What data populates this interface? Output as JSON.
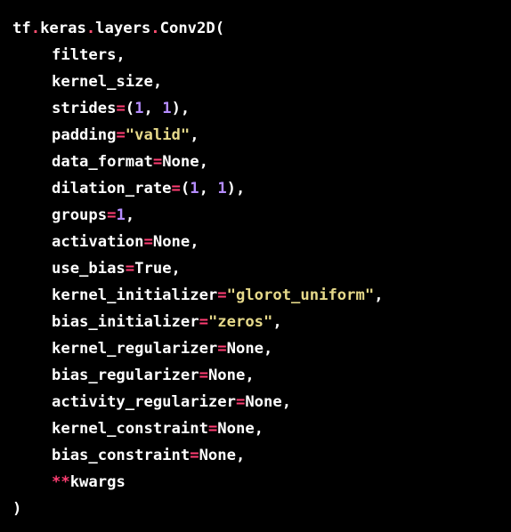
{
  "colors": {
    "background": "#000000",
    "text": "#ffffff",
    "operator": "#ff3e73",
    "number": "#b58cff",
    "string": "#e6d98a"
  },
  "code": {
    "line1": {
      "module": "tf",
      "dot1": ".",
      "sub1": "keras",
      "dot2": ".",
      "sub2": "layers",
      "dot3": ".",
      "call": "Conv2D(",
      "_text": "tf.keras.layers.Conv2D("
    },
    "line2": {
      "name": "filters,",
      "_text": "filters,"
    },
    "line3": {
      "name": "kernel_size,",
      "_text": "kernel_size,"
    },
    "line4": {
      "name": "strides",
      "op": "=",
      "p1": "(",
      "n1": "1",
      "sep": ", ",
      "n2": "1",
      "p2": "),",
      "_text": "strides=(1, 1),"
    },
    "line5": {
      "name": "padding",
      "op": "=",
      "value": "\"valid\"",
      "tail": ",",
      "_text": "padding=\"valid\","
    },
    "line6": {
      "name": "data_format",
      "op": "=",
      "value": "None,",
      "_text": "data_format=None,"
    },
    "line7": {
      "name": "dilation_rate",
      "op": "=",
      "p1": "(",
      "n1": "1",
      "sep": ", ",
      "n2": "1",
      "p2": "),",
      "_text": "dilation_rate=(1, 1),"
    },
    "line8": {
      "name": "groups",
      "op": "=",
      "n1": "1",
      "tail": ",",
      "_text": "groups=1,"
    },
    "line9": {
      "name": "activation",
      "op": "=",
      "value": "None,",
      "_text": "activation=None,"
    },
    "line10": {
      "name": "use_bias",
      "op": "=",
      "value": "True,",
      "_text": "use_bias=True,"
    },
    "line11": {
      "name": "kernel_initializer",
      "op": "=",
      "value": "\"glorot_uniform\"",
      "tail": ",",
      "_text": "kernel_initializer=\"glorot_uniform\","
    },
    "line12": {
      "name": "bias_initializer",
      "op": "=",
      "value": "\"zeros\"",
      "tail": ",",
      "_text": "bias_initializer=\"zeros\","
    },
    "line13": {
      "name": "kernel_regularizer",
      "op": "=",
      "value": "None,",
      "_text": "kernel_regularizer=None,"
    },
    "line14": {
      "name": "bias_regularizer",
      "op": "=",
      "value": "None,",
      "_text": "bias_regularizer=None,"
    },
    "line15": {
      "name": "activity_regularizer",
      "op": "=",
      "value": "None,",
      "_text": "activity_regularizer=None,"
    },
    "line16": {
      "name": "kernel_constraint",
      "op": "=",
      "value": "None,",
      "_text": "kernel_constraint=None,"
    },
    "line17": {
      "name": "bias_constraint",
      "op": "=",
      "value": "None,",
      "_text": "bias_constraint=None,"
    },
    "line18": {
      "op": "**",
      "name": "kwargs",
      "_text": "**kwargs"
    },
    "line19": {
      "close": ")",
      "_text": ")"
    }
  }
}
